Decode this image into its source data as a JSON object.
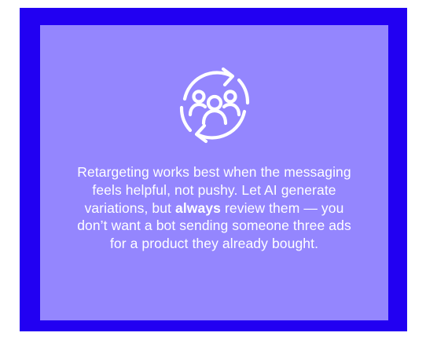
{
  "card": {
    "icon": "team-refresh-icon",
    "text": {
      "before": "Retargeting works best when the messaging feels helpful, not pushy. Let AI generate variations, but ",
      "emphasis": "always",
      "after": " review them — you don’t want a bot sending someone three ads for a product they already bought."
    }
  },
  "colors": {
    "frame": "#2200f2",
    "card": "#9486fe",
    "text": "#ffffff"
  }
}
